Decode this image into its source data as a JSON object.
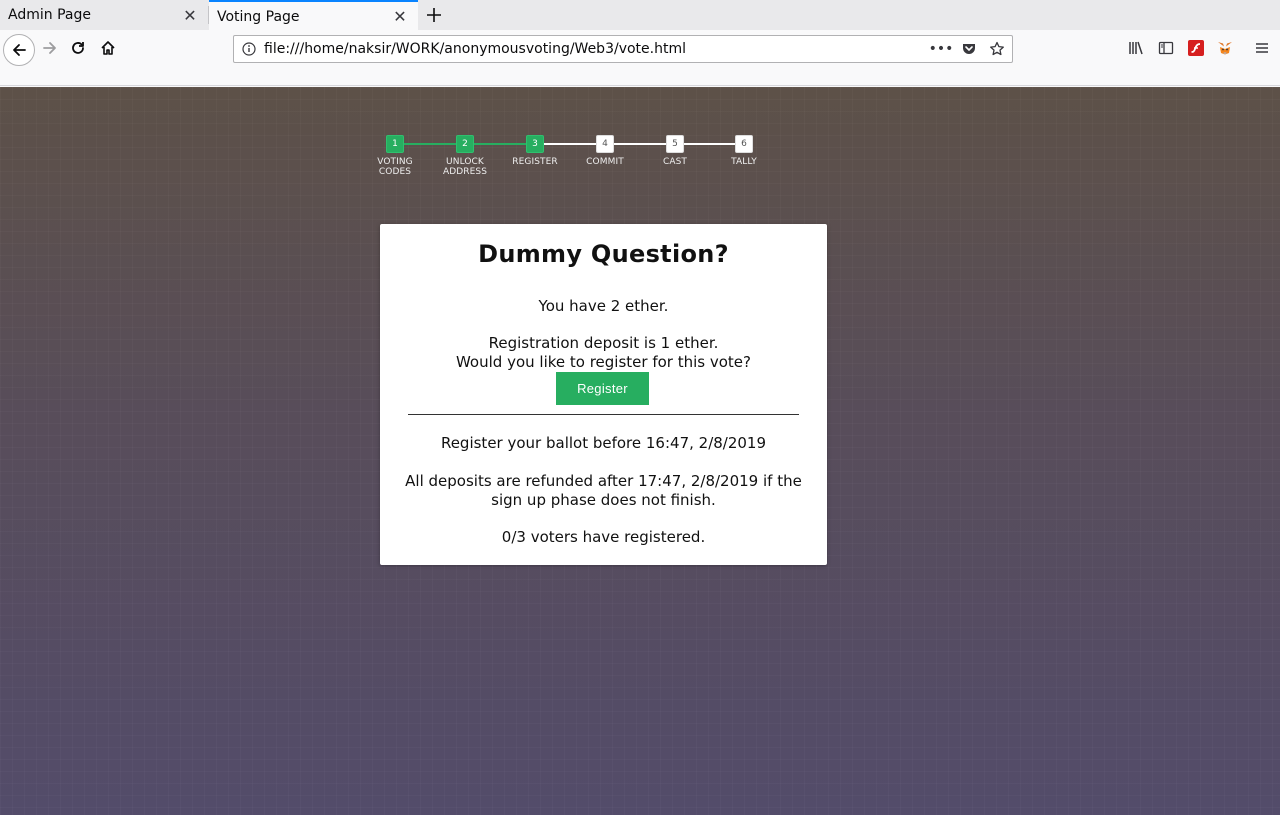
{
  "browser": {
    "tabs": [
      {
        "title": "Admin Page",
        "active": false
      },
      {
        "title": "Voting Page",
        "active": true
      }
    ],
    "url": "file:///home/naksir/WORK/anonymousvoting/Web3/vote.html",
    "icons": {
      "back": "arrow-left-icon",
      "forward": "arrow-right-icon",
      "reload": "reload-icon",
      "home": "home-icon",
      "info": "info-icon",
      "page_actions": "ellipsis-icon",
      "pocket": "pocket-icon",
      "bookmark": "star-icon",
      "library": "library-icon",
      "sidebar": "sidebar-icon",
      "flash": "flash-icon",
      "metamask": "metamask-fox-icon",
      "menu": "hamburger-menu-icon"
    }
  },
  "progress": {
    "steps": [
      {
        "num": "1",
        "label": "VOTING CODES",
        "done": true
      },
      {
        "num": "2",
        "label": "UNLOCK ADDRESS",
        "done": true
      },
      {
        "num": "3",
        "label": "REGISTER",
        "done": true
      },
      {
        "num": "4",
        "label": "COMMIT",
        "done": false
      },
      {
        "num": "5",
        "label": "CAST",
        "done": false
      },
      {
        "num": "6",
        "label": "TALLY",
        "done": false
      }
    ],
    "done_color": "#27ae60",
    "todo_color": "#ffffff"
  },
  "card": {
    "question": "Dummy Question?",
    "balance": "You have 2 ether.",
    "deposit_line1": "Registration deposit is 1 ether.",
    "deposit_line2": "Would you like to register for this vote?",
    "register_button": "Register",
    "deadline": "Register your ballot before 16:47, 2/8/2019",
    "refund_line1": "All deposits are refunded after 17:47, 2/8/2019 if the",
    "refund_line2": "sign up phase does not finish.",
    "voters": "0/3 voters have registered."
  },
  "colors": {
    "accent": "#27ae60",
    "tab_highlight": "#0a84ff"
  }
}
